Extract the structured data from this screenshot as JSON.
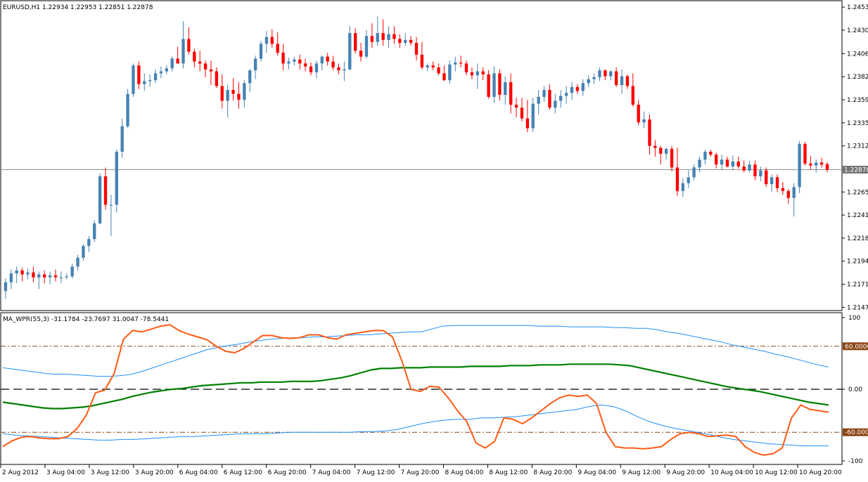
{
  "main_pane": {
    "header": "EURUSD,H1  1.22934 1.22953 1.22851 1.22878",
    "price_ticks": [
      "1.24535",
      "1.24300",
      "1.24060",
      "1.23825",
      "1.23590",
      "1.23355",
      "1.23120",
      "1.22650",
      "1.22415",
      "1.22180",
      "1.21945",
      "1.21710",
      "1.21475"
    ],
    "current_price_label": "1.22878",
    "colors": {
      "bull": "#4682b4",
      "bear": "#ff0000",
      "current_line": "#8c8c8c",
      "current_label_bg": "#737373"
    }
  },
  "sub_pane": {
    "header": "MA_WPR(55,3) -31.1784 -23.7697 31.0047 -78.5441",
    "axis_ticks": [
      "100",
      "60.0000",
      "0.00",
      "-60.0000",
      "-100"
    ],
    "colors": {
      "wpr": "#ff5a14",
      "ma": "#008000",
      "band": "#1e90ff",
      "level": "#8b4513",
      "level_label_bg": "#8b4513"
    }
  },
  "time_axis": [
    "2 Aug 2012",
    "3 Aug 04:00",
    "3 Aug 12:00",
    "3 Aug 20:00",
    "6 Aug 04:00",
    "6 Aug 12:00",
    "6 Aug 20:00",
    "7 Aug 04:00",
    "7 Aug 12:00",
    "7 Aug 20:00",
    "8 Aug 04:00",
    "8 Aug 12:00",
    "8 Aug 20:00",
    "9 Aug 04:00",
    "9 Aug 12:00",
    "9 Aug 20:00",
    "10 Aug 04:00",
    "10 Aug 12:00",
    "10 Aug 20:00"
  ],
  "chart_data": {
    "type": "candlestick",
    "symbol": "EURUSD",
    "timeframe": "H1",
    "ylim": [
      1.2147,
      1.2455
    ],
    "last": {
      "open": 1.22934,
      "high": 1.22953,
      "low": 1.22851,
      "close": 1.22878
    },
    "candles": [
      [
        1.2164,
        1.2177,
        1.2156,
        1.2173
      ],
      [
        1.2173,
        1.2186,
        1.2166,
        1.2182
      ],
      [
        1.2182,
        1.2189,
        1.2172,
        1.2185
      ],
      [
        1.2185,
        1.2188,
        1.2174,
        1.2181
      ],
      [
        1.2181,
        1.2187,
        1.2176,
        1.2183
      ],
      [
        1.2183,
        1.2189,
        1.2173,
        1.2178
      ],
      [
        1.2178,
        1.2184,
        1.2166,
        1.2181
      ],
      [
        1.2181,
        1.2185,
        1.2172,
        1.2178
      ],
      [
        1.2178,
        1.2184,
        1.2171,
        1.218
      ],
      [
        1.218,
        1.2186,
        1.2174,
        1.2178
      ],
      [
        1.2178,
        1.2184,
        1.2172,
        1.2178
      ],
      [
        1.2178,
        1.2182,
        1.2176,
        1.2179
      ],
      [
        1.2179,
        1.2192,
        1.2177,
        1.2189
      ],
      [
        1.2189,
        1.2201,
        1.2185,
        1.2198
      ],
      [
        1.2198,
        1.2212,
        1.2195,
        1.221
      ],
      [
        1.221,
        1.222,
        1.2204,
        1.2217
      ],
      [
        1.2217,
        1.2236,
        1.2214,
        1.2233
      ],
      [
        1.2233,
        1.2284,
        1.2232,
        1.2281
      ],
      [
        1.2281,
        1.229,
        1.2247,
        1.2252
      ],
      [
        1.2252,
        1.2262,
        1.222,
        1.2252
      ],
      [
        1.2252,
        1.2308,
        1.2244,
        1.2306
      ],
      [
        1.2306,
        1.234,
        1.23,
        1.2332
      ],
      [
        1.2332,
        1.237,
        1.233,
        1.2365
      ],
      [
        1.2365,
        1.2396,
        1.2362,
        1.2394
      ],
      [
        1.2394,
        1.2398,
        1.237,
        1.2375
      ],
      [
        1.2375,
        1.2386,
        1.2368,
        1.2378
      ],
      [
        1.2378,
        1.2385,
        1.2372,
        1.2379
      ],
      [
        1.2379,
        1.239,
        1.2376,
        1.2386
      ],
      [
        1.2386,
        1.2393,
        1.2381,
        1.2388
      ],
      [
        1.2388,
        1.2394,
        1.2385,
        1.2391
      ],
      [
        1.2391,
        1.2403,
        1.2388,
        1.2401
      ],
      [
        1.2401,
        1.2413,
        1.2396,
        1.2396
      ],
      [
        1.2396,
        1.2439,
        1.2391,
        1.2421
      ],
      [
        1.2421,
        1.2433,
        1.2405,
        1.2408
      ],
      [
        1.2408,
        1.2411,
        1.2392,
        1.2398
      ],
      [
        1.2398,
        1.2409,
        1.2388,
        1.2396
      ],
      [
        1.2396,
        1.2399,
        1.2382,
        1.239
      ],
      [
        1.239,
        1.2399,
        1.2374,
        1.2388
      ],
      [
        1.2388,
        1.2392,
        1.2371,
        1.2373
      ],
      [
        1.2373,
        1.2385,
        1.235,
        1.2358
      ],
      [
        1.2358,
        1.2374,
        1.2341,
        1.2369
      ],
      [
        1.2369,
        1.2381,
        1.2358,
        1.2365
      ],
      [
        1.2365,
        1.2377,
        1.235,
        1.2359
      ],
      [
        1.2359,
        1.2379,
        1.2351,
        1.2376
      ],
      [
        1.2376,
        1.239,
        1.2367,
        1.2389
      ],
      [
        1.2389,
        1.2404,
        1.238,
        1.2401
      ],
      [
        1.2401,
        1.2419,
        1.2398,
        1.2416
      ],
      [
        1.2416,
        1.2429,
        1.2407,
        1.2423
      ],
      [
        1.2423,
        1.2431,
        1.2412,
        1.2416
      ],
      [
        1.2416,
        1.2428,
        1.2404,
        1.2407
      ],
      [
        1.2407,
        1.2416,
        1.2389,
        1.2396
      ],
      [
        1.2396,
        1.2402,
        1.239,
        1.2398
      ],
      [
        1.2398,
        1.2403,
        1.2394,
        1.24
      ],
      [
        1.24,
        1.2405,
        1.239,
        1.2396
      ],
      [
        1.2396,
        1.2401,
        1.2388,
        1.2393
      ],
      [
        1.2393,
        1.2397,
        1.2384,
        1.2387
      ],
      [
        1.2387,
        1.2399,
        1.2381,
        1.2396
      ],
      [
        1.2396,
        1.2404,
        1.2389,
        1.2403
      ],
      [
        1.2403,
        1.2407,
        1.2394,
        1.2398
      ],
      [
        1.2398,
        1.2404,
        1.2389,
        1.2392
      ],
      [
        1.2392,
        1.2396,
        1.2385,
        1.2389
      ],
      [
        1.2389,
        1.2398,
        1.2378,
        1.239
      ],
      [
        1.239,
        1.2434,
        1.2389,
        1.2427
      ],
      [
        1.2427,
        1.2432,
        1.2406,
        1.2409
      ],
      [
        1.2409,
        1.2417,
        1.2398,
        1.2403
      ],
      [
        1.2403,
        1.243,
        1.2401,
        1.2424
      ],
      [
        1.2424,
        1.2437,
        1.2412,
        1.2418
      ],
      [
        1.2418,
        1.2444,
        1.2414,
        1.2427
      ],
      [
        1.2427,
        1.2441,
        1.2414,
        1.242
      ],
      [
        1.242,
        1.2434,
        1.2412,
        1.2426
      ],
      [
        1.2426,
        1.2434,
        1.2416,
        1.2421
      ],
      [
        1.2421,
        1.2426,
        1.2412,
        1.2417
      ],
      [
        1.2417,
        1.2427,
        1.2414,
        1.242
      ],
      [
        1.242,
        1.2424,
        1.2414,
        1.2417
      ],
      [
        1.2417,
        1.2423,
        1.2399,
        1.2405
      ],
      [
        1.2405,
        1.2418,
        1.239,
        1.2392
      ],
      [
        1.2392,
        1.2396,
        1.2388,
        1.2394
      ],
      [
        1.2394,
        1.2398,
        1.2389,
        1.2392
      ],
      [
        1.2392,
        1.2396,
        1.2384,
        1.2386
      ],
      [
        1.2386,
        1.2394,
        1.2378,
        1.2379
      ],
      [
        1.2379,
        1.2399,
        1.2375,
        1.2395
      ],
      [
        1.2395,
        1.2403,
        1.2388,
        1.2397
      ],
      [
        1.2397,
        1.2404,
        1.2392,
        1.2396
      ],
      [
        1.2396,
        1.2399,
        1.2384,
        1.2387
      ],
      [
        1.2387,
        1.2392,
        1.238,
        1.2384
      ],
      [
        1.2384,
        1.2396,
        1.237,
        1.2388
      ],
      [
        1.2388,
        1.2392,
        1.2379,
        1.2385
      ],
      [
        1.2385,
        1.2389,
        1.236,
        1.2362
      ],
      [
        1.2362,
        1.2393,
        1.2356,
        1.2386
      ],
      [
        1.2386,
        1.239,
        1.2358,
        1.2364
      ],
      [
        1.2364,
        1.2383,
        1.2354,
        1.2377
      ],
      [
        1.2377,
        1.2386,
        1.2345,
        1.2354
      ],
      [
        1.2354,
        1.2361,
        1.2341,
        1.2351
      ],
      [
        1.2351,
        1.2361,
        1.2337,
        1.234
      ],
      [
        1.234,
        1.2359,
        1.2326,
        1.233
      ],
      [
        1.233,
        1.2361,
        1.2326,
        1.2355
      ],
      [
        1.2355,
        1.2369,
        1.2344,
        1.2362
      ],
      [
        1.2362,
        1.2373,
        1.2357,
        1.2369
      ],
      [
        1.2369,
        1.2375,
        1.2349,
        1.2351
      ],
      [
        1.2351,
        1.2365,
        1.2345,
        1.2358
      ],
      [
        1.2358,
        1.2369,
        1.2351,
        1.2363
      ],
      [
        1.2363,
        1.2373,
        1.2355,
        1.2366
      ],
      [
        1.2366,
        1.2377,
        1.2359,
        1.2372
      ],
      [
        1.2372,
        1.2375,
        1.2365,
        1.2368
      ],
      [
        1.2368,
        1.238,
        1.2363,
        1.2376
      ],
      [
        1.2376,
        1.2384,
        1.2372,
        1.238
      ],
      [
        1.238,
        1.2386,
        1.2375,
        1.2382
      ],
      [
        1.2382,
        1.2392,
        1.2378,
        1.2389
      ],
      [
        1.2389,
        1.239,
        1.2379,
        1.2383
      ],
      [
        1.2383,
        1.2389,
        1.2379,
        1.2388
      ],
      [
        1.2388,
        1.2392,
        1.2372,
        1.2374
      ],
      [
        1.2374,
        1.239,
        1.2365,
        1.2383
      ],
      [
        1.2383,
        1.2385,
        1.237,
        1.2373
      ],
      [
        1.2373,
        1.2386,
        1.2352,
        1.2354
      ],
      [
        1.2354,
        1.2359,
        1.2333,
        1.2336
      ],
      [
        1.2336,
        1.2347,
        1.233,
        1.2339
      ],
      [
        1.2339,
        1.2344,
        1.2303,
        1.2312
      ],
      [
        1.2312,
        1.2318,
        1.2301,
        1.231
      ],
      [
        1.231,
        1.2312,
        1.2293,
        1.2304
      ],
      [
        1.2304,
        1.231,
        1.2298,
        1.2309
      ],
      [
        1.2309,
        1.2312,
        1.2286,
        1.229
      ],
      [
        1.229,
        1.231,
        1.2261,
        1.2266
      ],
      [
        1.2266,
        1.2279,
        1.226,
        1.2274
      ],
      [
        1.2274,
        1.2287,
        1.2269,
        1.228
      ],
      [
        1.228,
        1.2293,
        1.2277,
        1.229
      ],
      [
        1.229,
        1.2301,
        1.2285,
        1.2298
      ],
      [
        1.2298,
        1.2308,
        1.2293,
        1.2306
      ],
      [
        1.2306,
        1.2308,
        1.2301,
        1.2303
      ],
      [
        1.2303,
        1.2305,
        1.2289,
        1.2293
      ],
      [
        1.2293,
        1.2303,
        1.2288,
        1.2298
      ],
      [
        1.2298,
        1.2301,
        1.229,
        1.2291
      ],
      [
        1.2291,
        1.2302,
        1.2287,
        1.2296
      ],
      [
        1.2296,
        1.2301,
        1.2289,
        1.2291
      ],
      [
        1.2291,
        1.2297,
        1.2285,
        1.2287
      ],
      [
        1.2287,
        1.2297,
        1.2285,
        1.2293
      ],
      [
        1.2293,
        1.2297,
        1.2277,
        1.2281
      ],
      [
        1.2281,
        1.2291,
        1.2276,
        1.2287
      ],
      [
        1.2287,
        1.229,
        1.227,
        1.2273
      ],
      [
        1.2273,
        1.2283,
        1.2265,
        1.228
      ],
      [
        1.228,
        1.2283,
        1.2265,
        1.2269
      ],
      [
        1.2269,
        1.2275,
        1.2262,
        1.2266
      ],
      [
        1.2266,
        1.2268,
        1.2253,
        1.2259
      ],
      [
        1.2259,
        1.2274,
        1.224,
        1.227
      ],
      [
        1.227,
        1.2317,
        1.2264,
        1.2314
      ],
      [
        1.2314,
        1.2316,
        1.2292,
        1.2294
      ],
      [
        1.2294,
        1.2302,
        1.2288,
        1.2292
      ],
      [
        1.2292,
        1.2298,
        1.2285,
        1.2295
      ],
      [
        1.2295,
        1.23,
        1.229,
        1.2293
      ],
      [
        1.22934,
        1.22953,
        1.22851,
        1.22878
      ]
    ],
    "indicator": {
      "name": "MA_WPR(55,3)",
      "values_shown": [
        -31.1784,
        -23.7697,
        31.0047,
        -78.5441
      ],
      "ylim": [
        -100,
        100
      ],
      "levels": [
        60,
        0,
        -60
      ],
      "series": [
        {
          "values": [
            -80,
            -72,
            -67,
            -66,
            -68,
            -69,
            -69,
            -66,
            -55,
            -36,
            -5,
            -1,
            22,
            70,
            82,
            80,
            84,
            88,
            90,
            82,
            77,
            73,
            69,
            60,
            53,
            51,
            57,
            66,
            75,
            75,
            72,
            71,
            72,
            76,
            76,
            72,
            70,
            76,
            78,
            80,
            82,
            82,
            73,
            40,
            0,
            -3,
            4,
            3,
            -12,
            -30,
            -45,
            -75,
            -82,
            -73,
            -40,
            -42,
            -48,
            -40,
            -30,
            -20,
            -12,
            -8,
            -10,
            -8,
            -20,
            -60,
            -80,
            -82,
            -82,
            -83,
            -82,
            -80,
            -70,
            -62,
            -60,
            -62,
            -66,
            -65,
            -64,
            -66,
            -80,
            -88,
            -92,
            -90,
            -82,
            -40,
            -22,
            -28,
            -30,
            -32
          ]
        },
        {
          "values": [
            -18,
            -20,
            -22,
            -24,
            -26,
            -27,
            -27,
            -26,
            -25,
            -23,
            -20,
            -17,
            -14,
            -10,
            -7,
            -4,
            -2,
            0,
            1,
            3,
            5,
            6,
            7,
            8,
            9,
            9,
            10,
            10,
            10,
            11,
            11,
            11,
            12,
            14,
            16,
            19,
            23,
            27,
            29,
            29,
            30,
            30,
            30,
            31,
            31,
            31,
            31,
            32,
            32,
            32,
            32,
            33,
            33,
            33,
            34,
            34,
            34,
            35,
            35,
            35,
            35,
            35,
            34,
            33,
            30,
            27,
            24,
            21,
            18,
            15,
            12,
            9,
            6,
            3,
            1,
            -1,
            -3,
            -6,
            -9,
            -12,
            -15,
            -18,
            -20,
            -22
          ]
        },
        {
          "values": [
            30,
            28,
            26,
            24,
            22,
            21,
            21,
            20,
            19,
            18,
            18,
            19,
            21,
            25,
            30,
            35,
            40,
            45,
            50,
            55,
            58,
            61,
            63,
            66,
            68,
            70,
            71,
            72,
            72,
            73,
            73,
            74,
            75,
            76,
            76,
            77,
            78,
            79,
            80,
            80,
            84,
            88,
            89,
            89,
            89,
            89,
            89,
            89,
            89,
            89,
            88,
            88,
            88,
            87,
            87,
            87,
            87,
            86,
            86,
            85,
            85,
            83,
            80,
            78,
            75,
            72,
            69,
            66,
            62,
            59,
            56,
            53,
            49,
            46,
            42,
            38,
            34,
            31
          ]
        },
        {
          "values": [
            -62,
            -64,
            -65,
            -66,
            -67,
            -68,
            -69,
            -70,
            -71,
            -71,
            -70,
            -70,
            -69,
            -68,
            -67,
            -66,
            -66,
            -65,
            -64,
            -63,
            -62,
            -62,
            -62,
            -61,
            -60,
            -60,
            -60,
            -60,
            -60,
            -60,
            -59,
            -59,
            -58,
            -56,
            -52,
            -48,
            -45,
            -43,
            -42,
            -42,
            -40,
            -40,
            -39,
            -38,
            -36,
            -34,
            -32,
            -30,
            -28,
            -24,
            -22,
            -24,
            -30,
            -38,
            -45,
            -50,
            -54,
            -57,
            -60,
            -63,
            -67,
            -70,
            -72,
            -74,
            -76,
            -77,
            -78,
            -79,
            -79,
            -79
          ]
        }
      ]
    }
  }
}
